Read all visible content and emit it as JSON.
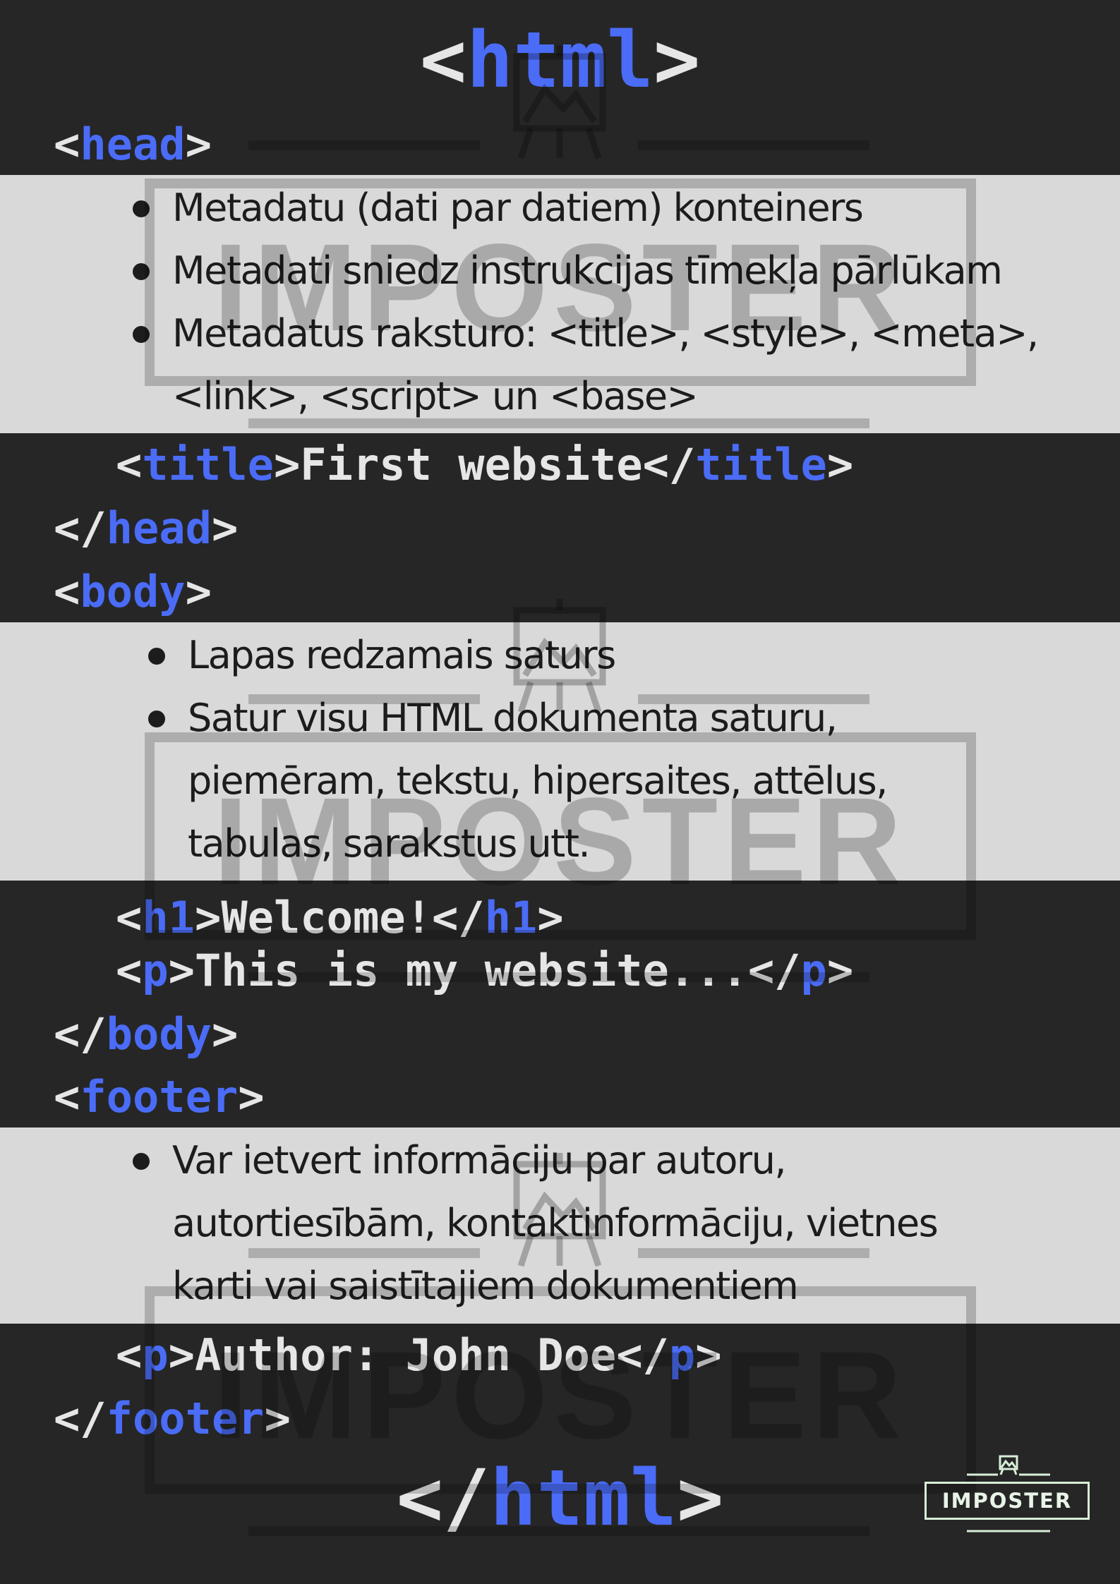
{
  "code": {
    "html_open": {
      "lt": "<",
      "tag": "html",
      "gt": ">"
    },
    "head_open": {
      "lt": "<",
      "tag": "head",
      "gt": ">"
    },
    "title_line": {
      "lt1": "<",
      "tag1": "title",
      "gt1": ">",
      "text": "First website",
      "lt2": "</",
      "tag2": "title",
      "gt2": ">"
    },
    "head_close": {
      "lt": "</",
      "tag": "head",
      "gt": ">"
    },
    "body_open": {
      "lt": "<",
      "tag": "body",
      "gt": ">"
    },
    "h1_line": {
      "lt1": "<",
      "tag1": "h1",
      "gt1": ">",
      "text": "Welcome!",
      "lt2": "</",
      "tag2": "h1",
      "gt2": ">"
    },
    "p_line": {
      "lt1": "<",
      "tag1": "p",
      "gt1": ">",
      "text": "This is my website...",
      "lt2": "</",
      "tag2": "p",
      "gt2": ">"
    },
    "body_close": {
      "lt": "</",
      "tag": "body",
      "gt": ">"
    },
    "footer_open": {
      "lt": "<",
      "tag": "footer",
      "gt": ">"
    },
    "author_line": {
      "lt1": "<",
      "tag1": "p",
      "gt1": ">",
      "text": "Author: John Doe",
      "lt2": "</",
      "tag2": "p",
      "gt2": ">"
    },
    "footer_close": {
      "lt": "</",
      "tag": "footer",
      "gt": ">"
    },
    "html_close": {
      "lt": "</",
      "tag": "html",
      "gt": ">"
    }
  },
  "head_notes": [
    "Metadatu (dati par datiem) konteiners",
    "Metadati sniedz instrukcijas tīmekļa pārlūkam",
    "Metadatus raksturo: <title>, <style>, <meta>,",
    "<link>, <script> un <base>"
  ],
  "body_notes": [
    "Lapas redzamais saturs",
    "Satur visu HTML dokumenta saturu,",
    "piemēram, tekstu, hipersaites, attēlus,",
    "tabulas, sarakstus utt."
  ],
  "footer_notes": [
    "Var ietvert informāciju par autoru,",
    "autortiesībām, kontaktinformāciju, vietnes",
    "karti vai saistītajiem dokumentiem"
  ],
  "watermark": {
    "text": "IMPOSTER",
    "icon": "easel-mountain-icon"
  },
  "logo": {
    "text": "IMPOSTER",
    "icon": "easel-mountain-icon"
  },
  "colors": {
    "background": "#262626",
    "band": "#d9d9d9",
    "tag": "#4a6cf7",
    "code_text": "#e6e6e6",
    "note_text": "#1c1c1c"
  }
}
